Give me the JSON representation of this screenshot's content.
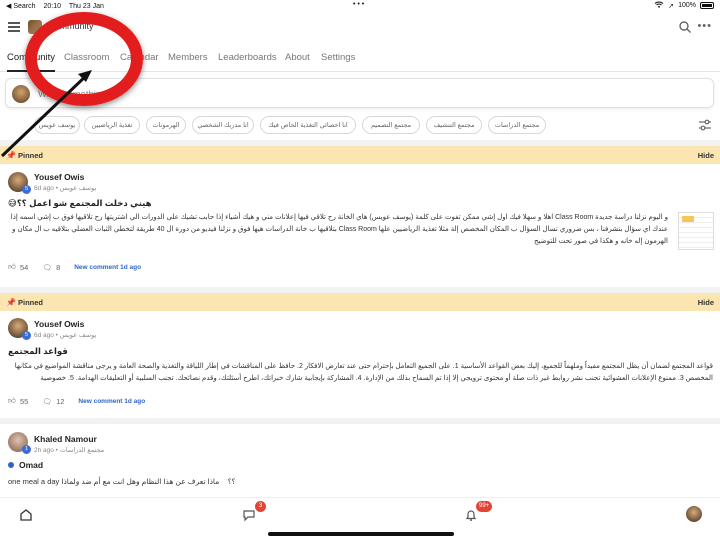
{
  "status_bar": {
    "back": "◀ Search",
    "time": "20:10",
    "date": "Thu 23 Jan",
    "battery": "100%"
  },
  "header": {
    "community_title": "Community"
  },
  "tabs": [
    {
      "label": "Community",
      "active": true
    },
    {
      "label": "Classroom",
      "active": false
    },
    {
      "label": "Calendar",
      "active": false
    },
    {
      "label": "Members",
      "active": false
    },
    {
      "label": "Leaderboards",
      "active": false
    },
    {
      "label": "About",
      "active": false
    },
    {
      "label": "Settings",
      "active": false
    }
  ],
  "composer": {
    "placeholder": "Write something"
  },
  "chips": [
    "يوسف عويس",
    "تغذية الرياضيين",
    "الهرمونات",
    "انا مدربك الشخصي",
    "انا اخصائي التغذية الخاص فيك",
    "مجتمع التصميم",
    "مجتمع التنشيف",
    "مجتمع الدراسات"
  ],
  "pinned_label": "Pinned",
  "hide_label": "Hide",
  "posts": [
    {
      "author": "Yousef Owis",
      "level": "5",
      "meta": "6d ago • يوسف عويس",
      "title": "😅هيني دخلت المجتمع شو اعمل ؟؟",
      "body": "و اليوم نزلنا دراسة جديدة Class Room اهلا و سهلا فيك اول إشي ممكن تفوت على كلمة (يوسف عويس) هاي الخانة رح تلاقي فيها إعلانات مني و هيك أشياء إذا حابب تشيك على الدورات الي اشتريتها رح تلاقيها فوق ب إشي اسمه إذا عندك اي سؤال بتشرفنا ، بس ضروري تسال السؤال ب المكان المخصص إلة مثلا تغذية الرياضيين علها Class Room بتلاقيها ب خانة الدراسات هيها فوق و نزلنا فيديو من دورة ال 40 طريقة لتخطي الثبات العضلي بتلاقيه ب ال مكان و الهرمون إله خانه و هكذا في صور تحت للتوضيح",
      "likes": "54",
      "comments": "8",
      "new_comment": "New comment 1d ago"
    },
    {
      "author": "Yousef Owis",
      "level": "5",
      "meta": "6d ago • يوسف عويس",
      "title": "قواعد المجتمع",
      "body": "قواعد المجتمع لضمان أن يظل المجتمع مفيداً وملهماً للجميع، إليك بعض القواعد الأساسية 1. على الجميع التعامل بإحترام حتى عند تعارض الافكار 2. حافظ على المناقشات في إطار اللياقة والتغذية والصحة العامة و يرجى مناقشة المواضيع في مكانها المخصص 3. ممنوع الإعلانات العشوائية تجنب نشر روابط غير ذات صلة أو محتوى ترويجي إلا إذا تم السماح بذلك من الإدارة. 4. المشاركة بإيجابية شارك خبراتك، اطرح أسئلتك، وقدم نصائحك. تجنب السلبية أو التعليقات الهدامة. 5. خصوصية",
      "likes": "55",
      "comments": "12",
      "new_comment": "New comment 1d ago"
    },
    {
      "author": "Khaled Namour",
      "level": "1",
      "meta": "2h ago • مجتمع الدراسات",
      "title": "Omad",
      "body_en": "one meal a day ؟؟",
      "body_ar": "ماذا تعرف عن هذا النظام وهل انت مع أم ضد ولماذا"
    }
  ],
  "bottom_nav": {
    "chat_badge": "3",
    "notif_badge": "99+"
  },
  "colors": {
    "pinned_bg": "#fbe6b2",
    "accent_blue": "#2f65c9",
    "badge_red": "#e24535",
    "annotation_red": "#e31d1d"
  }
}
